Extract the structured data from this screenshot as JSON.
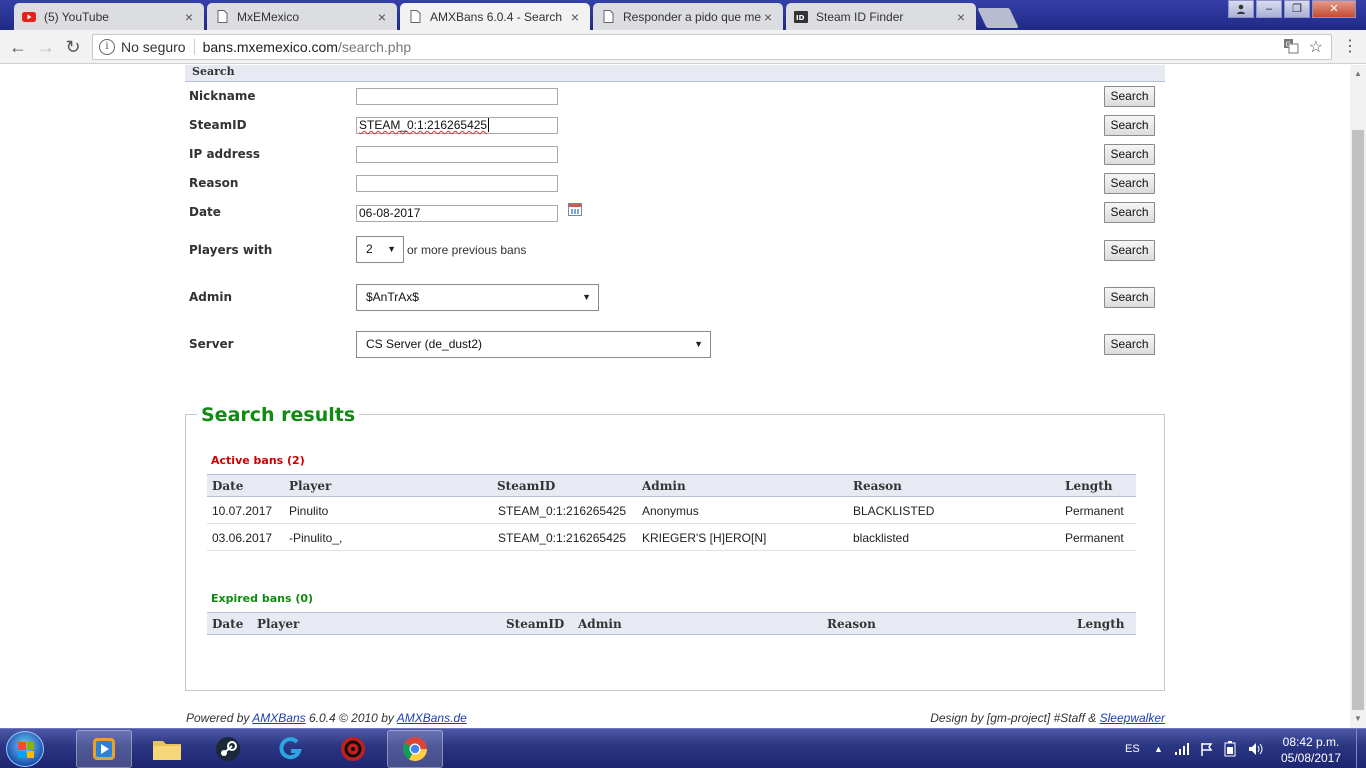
{
  "browser": {
    "tabs": [
      {
        "title": "(5) YouTube",
        "icon": "youtube-icon",
        "active": false
      },
      {
        "title": "MxEMexico",
        "icon": "page-icon",
        "active": false
      },
      {
        "title": "AMXBans 6.0.4 - Search",
        "icon": "page-icon",
        "active": true
      },
      {
        "title": "Responder a pido que me",
        "icon": "page-icon",
        "active": false
      },
      {
        "title": "Steam ID Finder",
        "icon": "id-icon",
        "active": false
      }
    ],
    "address": {
      "security": "No seguro",
      "host": "bans.mxemexico.com",
      "path": "/search.php"
    }
  },
  "search": {
    "header": "Search",
    "fields": [
      {
        "label": "Nickname",
        "value": "",
        "button": "Search"
      },
      {
        "label": "SteamID",
        "value": "STEAM_0:1:216265425",
        "button": "Search"
      },
      {
        "label": "IP address",
        "value": "",
        "button": "Search"
      },
      {
        "label": "Reason",
        "value": "",
        "button": "Search"
      },
      {
        "label": "Date",
        "value": "06-08-2017",
        "button": "Search"
      }
    ],
    "players_with": {
      "label": "Players with",
      "value": "2",
      "suffix": "or more previous bans",
      "button": "Search"
    },
    "admin": {
      "label": "Admin",
      "value": "$AnTrAx$",
      "button": "Search"
    },
    "server": {
      "label": "Server",
      "value": "CS Server (de_dust2)",
      "button": "Search"
    }
  },
  "results": {
    "title": "Search results",
    "active_title": "Active bans (2)",
    "expired_title": "Expired bans (0)",
    "columns": [
      "Date",
      "Player",
      "SteamID",
      "Admin",
      "Reason",
      "Length"
    ],
    "active_rows": [
      {
        "date": "10.07.2017",
        "player": "Pinulito",
        "steamid": "STEAM_0:1:216265425",
        "admin": "Anonymus",
        "reason": "BLACKLISTED",
        "length": "Permanent"
      },
      {
        "date": "03.06.2017",
        "player": "-Pinulito_,",
        "steamid": "STEAM_0:1:216265425",
        "admin": "KRIEGER'S [H]ERO[N]",
        "reason": "blacklisted",
        "length": "Permanent"
      }
    ]
  },
  "footer": {
    "powered_prefix": "Powered by ",
    "amxbans_link": "AMXBans",
    "powered_mid": " 6.0.4 © 2010 by ",
    "amxbans_de_link": "AMXBans.de",
    "design_prefix": "Design by [gm-project] #Staff & ",
    "sleepwalker_link": "Sleepwalker"
  },
  "taskbar": {
    "language": "ES",
    "time": "08:42 p.m.",
    "date": "05/08/2017"
  },
  "colors": {
    "results_title": "#118a11",
    "active_bans": "#d10000",
    "expired_bans": "#118a11",
    "table_header_bg": "#e8eaf3"
  }
}
